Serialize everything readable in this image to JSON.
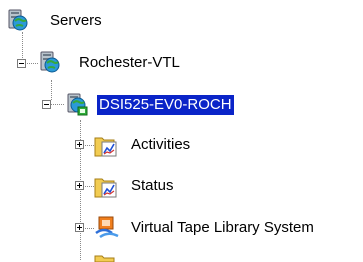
{
  "tree": {
    "root": {
      "label": "Servers",
      "icon": "servers-globe-icon"
    },
    "server_group": {
      "label": "Rochester-VTL",
      "icon": "server-globe-icon"
    },
    "server": {
      "label": "DSI525-EV0-ROCH",
      "icon": "connected-server-icon",
      "selected": true
    },
    "children": [
      {
        "label": "Activities",
        "icon": "folder-chart-icon",
        "collapsed": true
      },
      {
        "label": "Status",
        "icon": "folder-chart-icon",
        "collapsed": true
      },
      {
        "label": "Virtual Tape Library System",
        "icon": "tape-library-icon",
        "collapsed": true
      }
    ]
  },
  "colors": {
    "selection": "#0a24c8",
    "selection_text": "#ffffff"
  }
}
